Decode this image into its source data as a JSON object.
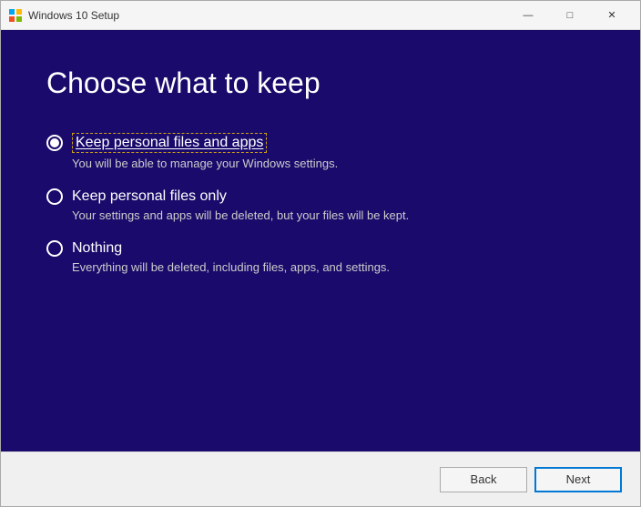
{
  "window": {
    "title": "Windows 10 Setup",
    "titlebar_buttons": {
      "minimize": "—",
      "restore": "□",
      "close": "✕"
    }
  },
  "page": {
    "title": "Choose what to keep",
    "options": [
      {
        "id": "keep-files-and-apps",
        "label": "Keep personal files and apps",
        "description": "You will be able to manage your Windows settings.",
        "selected": true
      },
      {
        "id": "keep-files-only",
        "label": "Keep personal files only",
        "description": "Your settings and apps will be deleted, but your files will be kept.",
        "selected": false
      },
      {
        "id": "nothing",
        "label": "Nothing",
        "description": "Everything will be deleted, including files, apps, and settings.",
        "selected": false
      }
    ]
  },
  "footer": {
    "back_label": "Back",
    "next_label": "Next"
  }
}
